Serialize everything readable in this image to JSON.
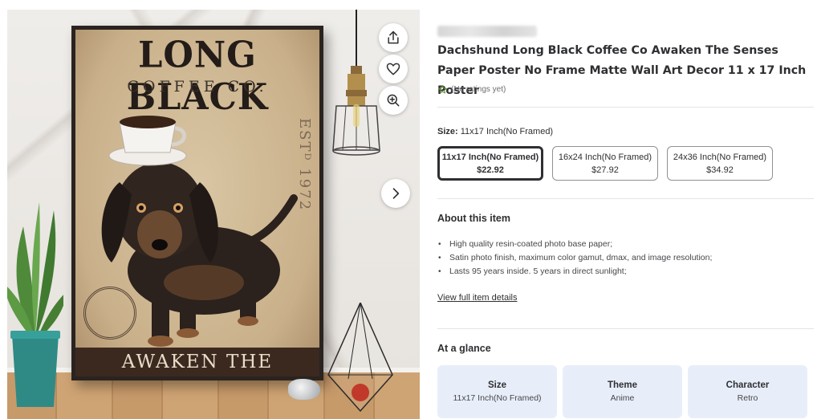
{
  "gallery": {
    "poster": {
      "title": "LONG BLACK",
      "subtitle": "COFFEE CO.",
      "established": "ESTᴰ 1972",
      "tagline": "AWAKEN THE SENSES"
    },
    "buttons": {
      "share": "share-icon",
      "favorite": "heart-icon",
      "zoom": "zoom-in-icon",
      "next": "chevron-right-icon"
    }
  },
  "product": {
    "title": "Dachshund Long Black Coffee Co Awaken The Senses Paper Poster No Frame Matte Wall Art Decor 11 x 17 Inch Poster",
    "rating_text": "(No ratings yet)"
  },
  "size": {
    "label": "Size:",
    "selected_value": "11x17 Inch(No Framed)",
    "options": [
      {
        "name": "11x17 Inch(No Framed)",
        "price": "$22.92",
        "selected": true
      },
      {
        "name": "16x24 Inch(No Framed)",
        "price": "$27.92",
        "selected": false
      },
      {
        "name": "24x36 Inch(No Framed)",
        "price": "$34.92",
        "selected": false
      }
    ]
  },
  "about": {
    "heading": "About this item",
    "bullets": [
      "High quality resin-coated photo base paper;",
      "Satin photo finish, maximum color gamut, dmax, and image resolution;",
      "Lasts 95 years inside. 5 years in direct sunlight;"
    ],
    "link": "View full item details"
  },
  "glance": {
    "heading": "At a glance",
    "cards": [
      {
        "key": "Size",
        "value": "11x17 Inch(No Framed)"
      },
      {
        "key": "Theme",
        "value": "Anime"
      },
      {
        "key": "Character",
        "value": "Retro"
      }
    ]
  },
  "colors": {
    "text": "#2e2f32",
    "muted": "#6d6e71",
    "card_bg": "#e8eef9",
    "border": "#909196",
    "star": "#5b8f2f"
  }
}
